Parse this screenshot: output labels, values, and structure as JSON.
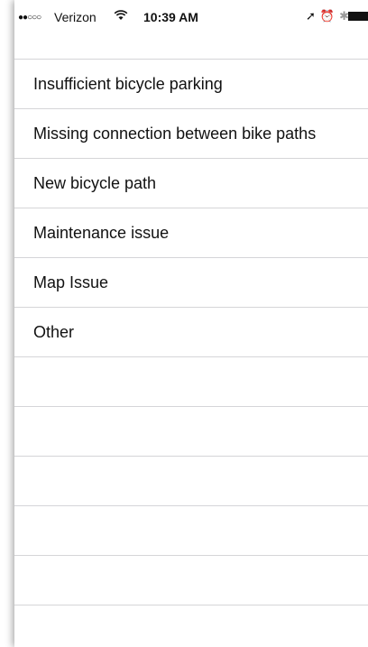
{
  "status_bar": {
    "signal": "●●○○○",
    "carrier": "Verizon",
    "wifi_icon": "wifi-icon",
    "time": "10:39 AM",
    "icons": [
      "location-arrow-icon",
      "alarm-icon",
      "bluetooth-icon",
      "battery-icon"
    ]
  },
  "list": {
    "items": [
      {
        "label": "Insufficient bicycle parking"
      },
      {
        "label": "Missing connection between bike paths"
      },
      {
        "label": "New bicycle path"
      },
      {
        "label": "Maintenance issue"
      },
      {
        "label": "Map Issue"
      },
      {
        "label": "Other"
      }
    ]
  }
}
